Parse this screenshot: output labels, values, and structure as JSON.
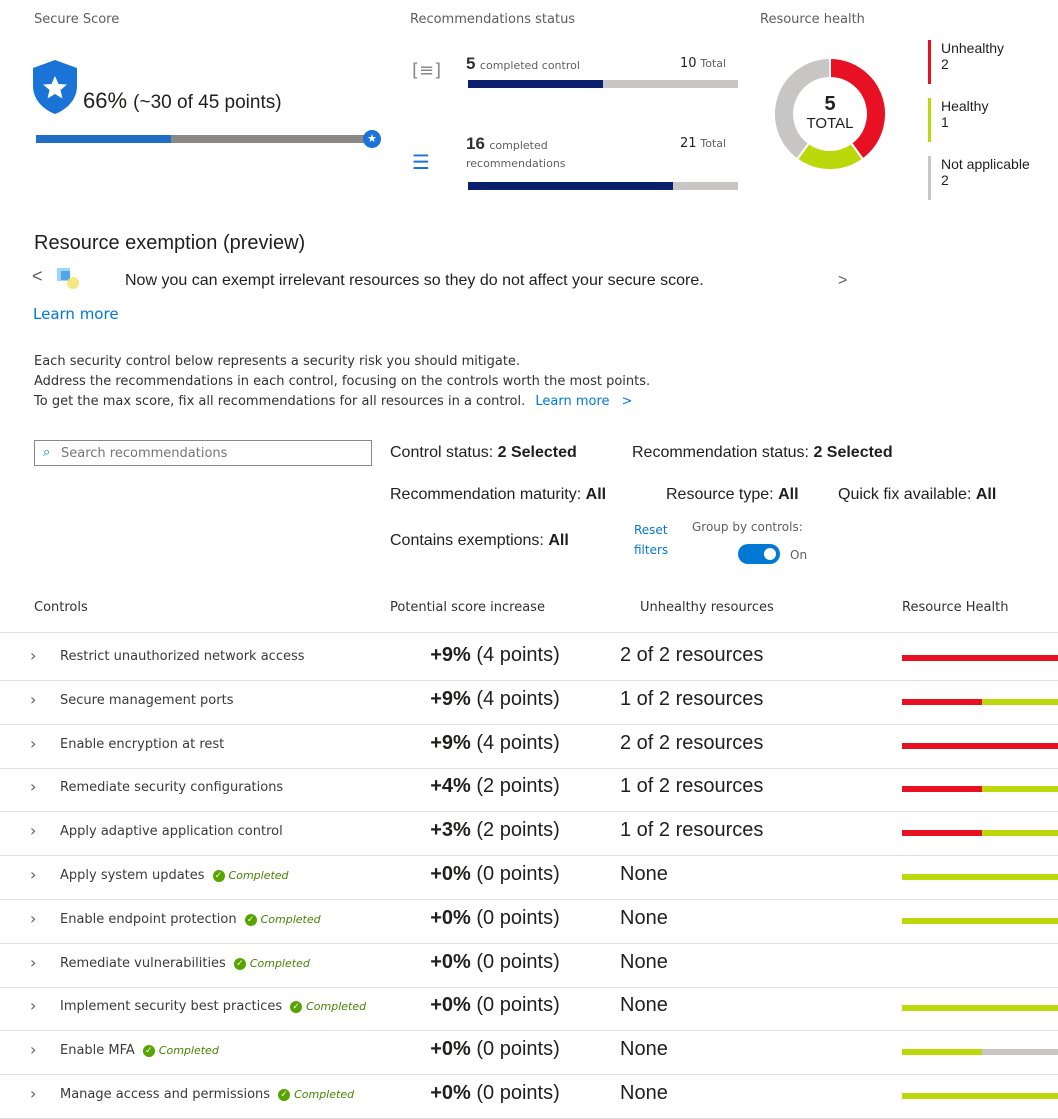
{
  "secure_score": {
    "label": "Secure Score",
    "percent": "66%",
    "points_text": "(~30 of 45 points)",
    "progress_fraction": 0.66
  },
  "rec_status": {
    "label": "Recommendations status",
    "controls": {
      "count": "5",
      "label": "completed control",
      "total": "10",
      "total_label": "Total",
      "fraction": 0.5
    },
    "recs": {
      "count": "16",
      "label1": "completed",
      "label2": "recommendations",
      "total": "21",
      "total_label": "Total",
      "fraction": 0.76
    }
  },
  "resource_health": {
    "label": "Resource health",
    "total": "5",
    "total_label": "TOTAL",
    "legend": [
      {
        "name": "Unhealthy",
        "value": "2",
        "color": "#e81123"
      },
      {
        "name": "Healthy",
        "value": "1",
        "color": "#bad80a"
      },
      {
        "name": "Not applicable",
        "value": "2",
        "color": "#c8c6c4"
      }
    ]
  },
  "exemption": {
    "title": "Resource exemption (preview)",
    "message": "Now you can exempt irrelevant resources so they do not affect your secure score.",
    "learn_more": "Learn more",
    "prev": "<",
    "next": ">"
  },
  "description": {
    "line1": "Each security control below represents a security risk you should mitigate.",
    "line2": "Address the recommendations in each control, focusing on the controls worth the most points.",
    "line3": "To get the max score, fix all recommendations for all resources in a control.",
    "learn_more": "Learn more",
    "arrow": ">"
  },
  "search": {
    "placeholder": "Search recommendations"
  },
  "filters": {
    "control_status": {
      "label": "Control status:",
      "value": "2 Selected"
    },
    "recommendation_status": {
      "label": "Recommendation status:",
      "value": "2 Selected"
    },
    "maturity": {
      "label": "Recommendation maturity:",
      "value": "All"
    },
    "resource_type": {
      "label": "Resource type:",
      "value": "All"
    },
    "quick_fix": {
      "label": "Quick fix available:",
      "value": "All"
    },
    "exemptions": {
      "label": "Contains exemptions:",
      "value": "All"
    },
    "reset1": "Reset",
    "reset2": "filters",
    "group_by": "Group by controls:",
    "toggle_state": "On"
  },
  "table": {
    "headers": [
      "Controls",
      "Potential score increase",
      "Unhealthy resources",
      "Resource Health"
    ],
    "rows": [
      {
        "name": "Restrict unauthorized network access",
        "completed": false,
        "score_pct": "+9%",
        "score_pts": "(4 points)",
        "unhealthy": "2 of 2 resources",
        "health": [
          1.0,
          0.0,
          0.0
        ]
      },
      {
        "name": "Secure management ports",
        "completed": false,
        "score_pct": "+9%",
        "score_pts": "(4 points)",
        "unhealthy": "1 of 2 resources",
        "health": [
          0.5,
          0.5,
          0.0
        ]
      },
      {
        "name": "Enable encryption at rest",
        "completed": false,
        "score_pct": "+9%",
        "score_pts": "(4 points)",
        "unhealthy": "2 of 2 resources",
        "health": [
          1.0,
          0.0,
          0.0
        ]
      },
      {
        "name": "Remediate security configurations",
        "completed": false,
        "score_pct": "+4%",
        "score_pts": "(2 points)",
        "unhealthy": "1 of 2 resources",
        "health": [
          0.5,
          0.5,
          0.0
        ]
      },
      {
        "name": "Apply adaptive application control",
        "completed": false,
        "score_pct": "+3%",
        "score_pts": "(2 points)",
        "unhealthy": "1 of 2 resources",
        "health": [
          0.5,
          0.5,
          0.0
        ]
      },
      {
        "name": "Apply system updates",
        "completed": true,
        "score_pct": "+0%",
        "score_pts": "(0 points)",
        "unhealthy": "None",
        "health": [
          0.0,
          1.0,
          0.0
        ]
      },
      {
        "name": "Enable endpoint protection",
        "completed": true,
        "score_pct": "+0%",
        "score_pts": "(0 points)",
        "unhealthy": "None",
        "health": [
          0.0,
          1.0,
          0.0
        ]
      },
      {
        "name": "Remediate vulnerabilities",
        "completed": true,
        "score_pct": "+0%",
        "score_pts": "(0 points)",
        "unhealthy": "None",
        "health": [
          0.0,
          0.0,
          0.0
        ]
      },
      {
        "name": "Implement security best practices",
        "completed": true,
        "score_pct": "+0%",
        "score_pts": "(0 points)",
        "unhealthy": "None",
        "health": [
          0.0,
          1.0,
          0.0
        ]
      },
      {
        "name": "Enable MFA",
        "completed": true,
        "score_pct": "+0%",
        "score_pts": "(0 points)",
        "unhealthy": "None",
        "health": [
          0.0,
          0.5,
          0.5
        ]
      },
      {
        "name": "Manage access and permissions",
        "completed": true,
        "score_pct": "+0%",
        "score_pts": "(0 points)",
        "unhealthy": "None",
        "health": [
          0.0,
          1.0,
          0.0
        ]
      }
    ],
    "completed_label": "Completed"
  },
  "colors": {
    "unhealthy": "#e81123",
    "healthy": "#bad80a",
    "na": "#c8c6c4",
    "accent": "#0078d4",
    "navy": "#0b1f6e"
  }
}
